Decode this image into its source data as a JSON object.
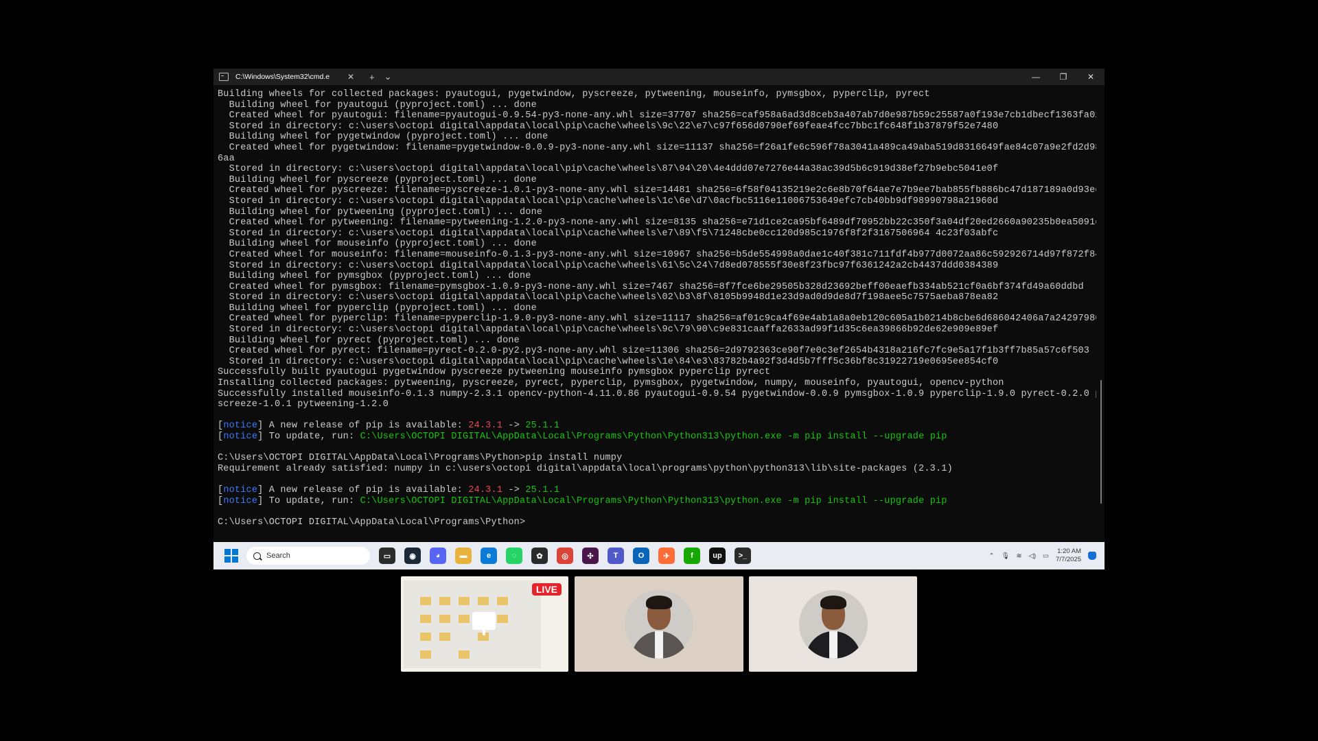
{
  "window": {
    "tab_title": "C:\\Windows\\System32\\cmd.e",
    "new_tab": "+",
    "dropdown": "⌄",
    "close_tab": "✕",
    "minimize": "—",
    "maximize": "❐",
    "close": "✕"
  },
  "console": {
    "lines": [
      [
        {
          "t": "Building wheels for collected packages: pyautogui, pygetwindow, pyscreeze, pytweening, mouseinfo, pymsgbox, pyperclip, pyrect"
        }
      ],
      [
        {
          "t": "  Building wheel for pyautogui (pyproject.toml) ... done"
        }
      ],
      [
        {
          "t": "  Created wheel for pyautogui: filename=pyautogui-0.9.54-py3-none-any.whl size=37707 sha256=caf958a6ad3d8ceb3a407ab7d0e987b59c25587a0f193e7cb1dbecf1363fa020"
        }
      ],
      [
        {
          "t": "  Stored in directory: c:\\users\\octopi digital\\appdata\\local\\pip\\cache\\wheels\\9c\\22\\e7\\c97f656d0790ef69feae4fcc7bbc1fc648f1b37879f52e7480"
        }
      ],
      [
        {
          "t": "  Building wheel for pygetwindow (pyproject.toml) ... done"
        }
      ],
      [
        {
          "t": "  Created wheel for pygetwindow: filename=pygetwindow-0.0.9-py3-none-any.whl size=11137 sha256=f26a1fe6c596f78a3041a489ca49aba519d8316649fae84c07a9e2fd2d988"
        }
      ],
      [
        {
          "t": "6aa"
        }
      ],
      [
        {
          "t": "  Stored in directory: c:\\users\\octopi digital\\appdata\\local\\pip\\cache\\wheels\\87\\94\\20\\4e4ddd07e7276e44a38ac39d5b6c919d38ef27b9ebc5041e0f"
        }
      ],
      [
        {
          "t": "  Building wheel for pyscreeze (pyproject.toml) ... done"
        }
      ],
      [
        {
          "t": "  Created wheel for pyscreeze: filename=pyscreeze-1.0.1-py3-none-any.whl size=14481 sha256=6f58f04135219e2c6e8b70f64ae7e7b9ee7bab855fb886bc47d187189a0d93ed"
        }
      ],
      [
        {
          "t": "  Stored in directory: c:\\users\\octopi digital\\appdata\\local\\pip\\cache\\wheels\\1c\\6e\\d7\\0acfbc5116e11006753649efc7cb40bb9df98990798a21960d"
        }
      ],
      [
        {
          "t": "  Building wheel for pytweening (pyproject.toml) ... done"
        }
      ],
      [
        {
          "t": "  Created wheel for pytweening: filename=pytweening-1.2.0-py3-none-any.whl size=8135 sha256=e71d1ce2ca95bf6489df70952bb22c350f3a04df20ed2660a90235b0ea5091ec"
        }
      ],
      [
        {
          "t": "  Stored in directory: c:\\users\\octopi digital\\appdata\\local\\pip\\cache\\wheels\\e7\\89\\f5\\71248cbe0cc120d985c1976f8f2f3167506964 4c23f03abfc"
        }
      ],
      [
        {
          "t": "  Building wheel for mouseinfo (pyproject.toml) ... done"
        }
      ],
      [
        {
          "t": "  Created wheel for mouseinfo: filename=mouseinfo-0.1.3-py3-none-any.whl size=10967 sha256=b5de554998a0dae1c40f381c711fdf4b977d0072aa86c592926714d97f872f84"
        }
      ],
      [
        {
          "t": "  Stored in directory: c:\\users\\octopi digital\\appdata\\local\\pip\\cache\\wheels\\61\\5c\\24\\7d8ed078555f30e8f23fbc97f6361242a2cb4437ddd0384389"
        }
      ],
      [
        {
          "t": "  Building wheel for pymsgbox (pyproject.toml) ... done"
        }
      ],
      [
        {
          "t": "  Created wheel for pymsgbox: filename=pymsgbox-1.0.9-py3-none-any.whl size=7467 sha256=8f7fce6be29505b328d23692beff00eaefb334ab521cf0a6bf374fd49a60ddbd"
        }
      ],
      [
        {
          "t": "  Stored in directory: c:\\users\\octopi digital\\appdata\\local\\pip\\cache\\wheels\\02\\b3\\8f\\8105b9948d1e23d9ad0d9de8d7f198aee5c7575aeba878ea82"
        }
      ],
      [
        {
          "t": "  Building wheel for pyperclip (pyproject.toml) ... done"
        }
      ],
      [
        {
          "t": "  Created wheel for pyperclip: filename=pyperclip-1.9.0-py3-none-any.whl size=11117 sha256=af01c9ca4f69e4ab1a8a0eb120c605a1b0214b8cbe6d686042406a7a24297980"
        }
      ],
      [
        {
          "t": "  Stored in directory: c:\\users\\octopi digital\\appdata\\local\\pip\\cache\\wheels\\9c\\79\\90\\c9e831caaffa2633ad99f1d35c6ea39866b92de62e909e89ef"
        }
      ],
      [
        {
          "t": "  Building wheel for pyrect (pyproject.toml) ... done"
        }
      ],
      [
        {
          "t": "  Created wheel for pyrect: filename=pyrect-0.2.0-py2.py3-none-any.whl size=11306 sha256=2d9792363ce90f7e0c3ef2654b4318a216fc7fc9e5a17f1b3ff7b85a57c6f503"
        }
      ],
      [
        {
          "t": "  Stored in directory: c:\\users\\octopi digital\\appdata\\local\\pip\\cache\\wheels\\1e\\84\\e3\\83782b4a92f3d4d5b7fff5c36bf8c31922719e0695ee854cf0"
        }
      ],
      [
        {
          "t": "Successfully built pyautogui pygetwindow pyscreeze pytweening mouseinfo pymsgbox pyperclip pyrect"
        }
      ],
      [
        {
          "t": "Installing collected packages: pytweening, pyscreeze, pyrect, pyperclip, pymsgbox, pygetwindow, numpy, mouseinfo, pyautogui, opencv-python"
        }
      ],
      [
        {
          "t": "Successfully installed mouseinfo-0.1.3 numpy-2.3.1 opencv-python-4.11.0.86 pyautogui-0.9.54 pygetwindow-0.0.9 pymsgbox-1.0.9 pyperclip-1.9.0 pyrect-0.2.0 py"
        }
      ],
      [
        {
          "t": "screeze-1.0.1 pytweening-1.2.0"
        }
      ],
      [
        {
          "t": ""
        }
      ],
      [
        {
          "t": "["
        },
        {
          "t": "notice",
          "c": "c-notice"
        },
        {
          "t": "] A new release of pip is available: "
        },
        {
          "t": "24.3.1",
          "c": "c-red"
        },
        {
          "t": " -> "
        },
        {
          "t": "25.1.1",
          "c": "c-green"
        }
      ],
      [
        {
          "t": "["
        },
        {
          "t": "notice",
          "c": "c-notice"
        },
        {
          "t": "] To update, run: "
        },
        {
          "t": "C:\\Users\\OCTOPI DIGITAL\\AppData\\Local\\Programs\\Python\\Python313\\python.exe -m pip install --upgrade pip",
          "c": "c-green"
        }
      ],
      [
        {
          "t": ""
        }
      ],
      [
        {
          "t": "C:\\Users\\OCTOPI DIGITAL\\AppData\\Local\\Programs\\Python>pip install numpy"
        }
      ],
      [
        {
          "t": "Requirement already satisfied: numpy in c:\\users\\octopi digital\\appdata\\local\\programs\\python\\python313\\lib\\site-packages (2.3.1)"
        }
      ],
      [
        {
          "t": ""
        }
      ],
      [
        {
          "t": "["
        },
        {
          "t": "notice",
          "c": "c-notice"
        },
        {
          "t": "] A new release of pip is available: "
        },
        {
          "t": "24.3.1",
          "c": "c-red"
        },
        {
          "t": " -> "
        },
        {
          "t": "25.1.1",
          "c": "c-green"
        }
      ],
      [
        {
          "t": "["
        },
        {
          "t": "notice",
          "c": "c-notice"
        },
        {
          "t": "] To update, run: "
        },
        {
          "t": "C:\\Users\\OCTOPI DIGITAL\\AppData\\Local\\Programs\\Python\\Python313\\python.exe -m pip install --upgrade pip",
          "c": "c-green"
        }
      ],
      [
        {
          "t": ""
        }
      ],
      [
        {
          "t": "C:\\Users\\OCTOPI DIGITAL\\AppData\\Local\\Programs\\Python>"
        }
      ]
    ]
  },
  "taskbar": {
    "search_placeholder": "Search",
    "apps": [
      {
        "name": "file-explorer-icon",
        "glyph": "▭",
        "color": "#2b2b2b"
      },
      {
        "name": "steam-icon",
        "glyph": "◉",
        "color": "#1b2838"
      },
      {
        "name": "discord-icon",
        "glyph": "◕",
        "color": "#5865f2"
      },
      {
        "name": "folder-icon",
        "glyph": "▬",
        "color": "#e8b33a"
      },
      {
        "name": "edge-icon",
        "glyph": "e",
        "color": "#0c7bd6"
      },
      {
        "name": "whatsapp-icon",
        "glyph": "◌",
        "color": "#25d366"
      },
      {
        "name": "chatgpt-icon",
        "glyph": "✿",
        "color": "#2b2b2b"
      },
      {
        "name": "chrome-icon",
        "glyph": "◎",
        "color": "#db4437"
      },
      {
        "name": "slack-icon",
        "glyph": "✣",
        "color": "#4a154b"
      },
      {
        "name": "teams-icon",
        "glyph": "T",
        "color": "#5059c9"
      },
      {
        "name": "outlook-icon",
        "glyph": "O",
        "color": "#0a64b8"
      },
      {
        "name": "postman-icon",
        "glyph": "✈",
        "color": "#ff6c37"
      },
      {
        "name": "upwork-green-icon",
        "glyph": "f",
        "color": "#14a800"
      },
      {
        "name": "upwork-icon",
        "glyph": "up",
        "color": "#111111"
      },
      {
        "name": "terminal-icon",
        "glyph": ">_",
        "color": "#2b2b2b"
      }
    ],
    "time": "1:20 AM",
    "date": "7/7/2025"
  },
  "participants": {
    "live_label": "LIVE"
  }
}
